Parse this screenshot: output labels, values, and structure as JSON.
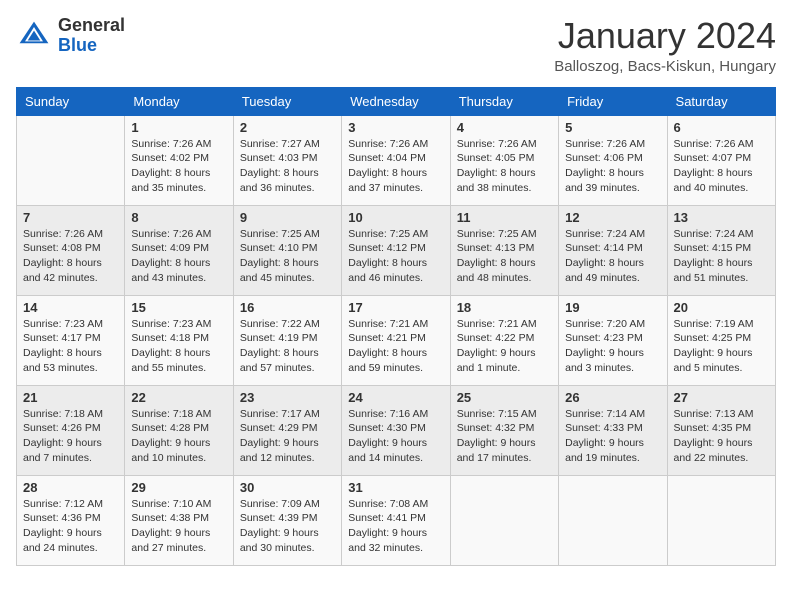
{
  "logo": {
    "general": "General",
    "blue": "Blue"
  },
  "title": "January 2024",
  "location": "Balloszog, Bacs-Kiskun, Hungary",
  "days_of_week": [
    "Sunday",
    "Monday",
    "Tuesday",
    "Wednesday",
    "Thursday",
    "Friday",
    "Saturday"
  ],
  "weeks": [
    [
      {
        "day": "",
        "sunrise": "",
        "sunset": "",
        "daylight": ""
      },
      {
        "day": "1",
        "sunrise": "Sunrise: 7:26 AM",
        "sunset": "Sunset: 4:02 PM",
        "daylight": "Daylight: 8 hours and 35 minutes."
      },
      {
        "day": "2",
        "sunrise": "Sunrise: 7:27 AM",
        "sunset": "Sunset: 4:03 PM",
        "daylight": "Daylight: 8 hours and 36 minutes."
      },
      {
        "day": "3",
        "sunrise": "Sunrise: 7:26 AM",
        "sunset": "Sunset: 4:04 PM",
        "daylight": "Daylight: 8 hours and 37 minutes."
      },
      {
        "day": "4",
        "sunrise": "Sunrise: 7:26 AM",
        "sunset": "Sunset: 4:05 PM",
        "daylight": "Daylight: 8 hours and 38 minutes."
      },
      {
        "day": "5",
        "sunrise": "Sunrise: 7:26 AM",
        "sunset": "Sunset: 4:06 PM",
        "daylight": "Daylight: 8 hours and 39 minutes."
      },
      {
        "day": "6",
        "sunrise": "Sunrise: 7:26 AM",
        "sunset": "Sunset: 4:07 PM",
        "daylight": "Daylight: 8 hours and 40 minutes."
      }
    ],
    [
      {
        "day": "7",
        "sunrise": "Sunrise: 7:26 AM",
        "sunset": "Sunset: 4:08 PM",
        "daylight": "Daylight: 8 hours and 42 minutes."
      },
      {
        "day": "8",
        "sunrise": "Sunrise: 7:26 AM",
        "sunset": "Sunset: 4:09 PM",
        "daylight": "Daylight: 8 hours and 43 minutes."
      },
      {
        "day": "9",
        "sunrise": "Sunrise: 7:25 AM",
        "sunset": "Sunset: 4:10 PM",
        "daylight": "Daylight: 8 hours and 45 minutes."
      },
      {
        "day": "10",
        "sunrise": "Sunrise: 7:25 AM",
        "sunset": "Sunset: 4:12 PM",
        "daylight": "Daylight: 8 hours and 46 minutes."
      },
      {
        "day": "11",
        "sunrise": "Sunrise: 7:25 AM",
        "sunset": "Sunset: 4:13 PM",
        "daylight": "Daylight: 8 hours and 48 minutes."
      },
      {
        "day": "12",
        "sunrise": "Sunrise: 7:24 AM",
        "sunset": "Sunset: 4:14 PM",
        "daylight": "Daylight: 8 hours and 49 minutes."
      },
      {
        "day": "13",
        "sunrise": "Sunrise: 7:24 AM",
        "sunset": "Sunset: 4:15 PM",
        "daylight": "Daylight: 8 hours and 51 minutes."
      }
    ],
    [
      {
        "day": "14",
        "sunrise": "Sunrise: 7:23 AM",
        "sunset": "Sunset: 4:17 PM",
        "daylight": "Daylight: 8 hours and 53 minutes."
      },
      {
        "day": "15",
        "sunrise": "Sunrise: 7:23 AM",
        "sunset": "Sunset: 4:18 PM",
        "daylight": "Daylight: 8 hours and 55 minutes."
      },
      {
        "day": "16",
        "sunrise": "Sunrise: 7:22 AM",
        "sunset": "Sunset: 4:19 PM",
        "daylight": "Daylight: 8 hours and 57 minutes."
      },
      {
        "day": "17",
        "sunrise": "Sunrise: 7:21 AM",
        "sunset": "Sunset: 4:21 PM",
        "daylight": "Daylight: 8 hours and 59 minutes."
      },
      {
        "day": "18",
        "sunrise": "Sunrise: 7:21 AM",
        "sunset": "Sunset: 4:22 PM",
        "daylight": "Daylight: 9 hours and 1 minute."
      },
      {
        "day": "19",
        "sunrise": "Sunrise: 7:20 AM",
        "sunset": "Sunset: 4:23 PM",
        "daylight": "Daylight: 9 hours and 3 minutes."
      },
      {
        "day": "20",
        "sunrise": "Sunrise: 7:19 AM",
        "sunset": "Sunset: 4:25 PM",
        "daylight": "Daylight: 9 hours and 5 minutes."
      }
    ],
    [
      {
        "day": "21",
        "sunrise": "Sunrise: 7:18 AM",
        "sunset": "Sunset: 4:26 PM",
        "daylight": "Daylight: 9 hours and 7 minutes."
      },
      {
        "day": "22",
        "sunrise": "Sunrise: 7:18 AM",
        "sunset": "Sunset: 4:28 PM",
        "daylight": "Daylight: 9 hours and 10 minutes."
      },
      {
        "day": "23",
        "sunrise": "Sunrise: 7:17 AM",
        "sunset": "Sunset: 4:29 PM",
        "daylight": "Daylight: 9 hours and 12 minutes."
      },
      {
        "day": "24",
        "sunrise": "Sunrise: 7:16 AM",
        "sunset": "Sunset: 4:30 PM",
        "daylight": "Daylight: 9 hours and 14 minutes."
      },
      {
        "day": "25",
        "sunrise": "Sunrise: 7:15 AM",
        "sunset": "Sunset: 4:32 PM",
        "daylight": "Daylight: 9 hours and 17 minutes."
      },
      {
        "day": "26",
        "sunrise": "Sunrise: 7:14 AM",
        "sunset": "Sunset: 4:33 PM",
        "daylight": "Daylight: 9 hours and 19 minutes."
      },
      {
        "day": "27",
        "sunrise": "Sunrise: 7:13 AM",
        "sunset": "Sunset: 4:35 PM",
        "daylight": "Daylight: 9 hours and 22 minutes."
      }
    ],
    [
      {
        "day": "28",
        "sunrise": "Sunrise: 7:12 AM",
        "sunset": "Sunset: 4:36 PM",
        "daylight": "Daylight: 9 hours and 24 minutes."
      },
      {
        "day": "29",
        "sunrise": "Sunrise: 7:10 AM",
        "sunset": "Sunset: 4:38 PM",
        "daylight": "Daylight: 9 hours and 27 minutes."
      },
      {
        "day": "30",
        "sunrise": "Sunrise: 7:09 AM",
        "sunset": "Sunset: 4:39 PM",
        "daylight": "Daylight: 9 hours and 30 minutes."
      },
      {
        "day": "31",
        "sunrise": "Sunrise: 7:08 AM",
        "sunset": "Sunset: 4:41 PM",
        "daylight": "Daylight: 9 hours and 32 minutes."
      },
      {
        "day": "",
        "sunrise": "",
        "sunset": "",
        "daylight": ""
      },
      {
        "day": "",
        "sunrise": "",
        "sunset": "",
        "daylight": ""
      },
      {
        "day": "",
        "sunrise": "",
        "sunset": "",
        "daylight": ""
      }
    ]
  ]
}
